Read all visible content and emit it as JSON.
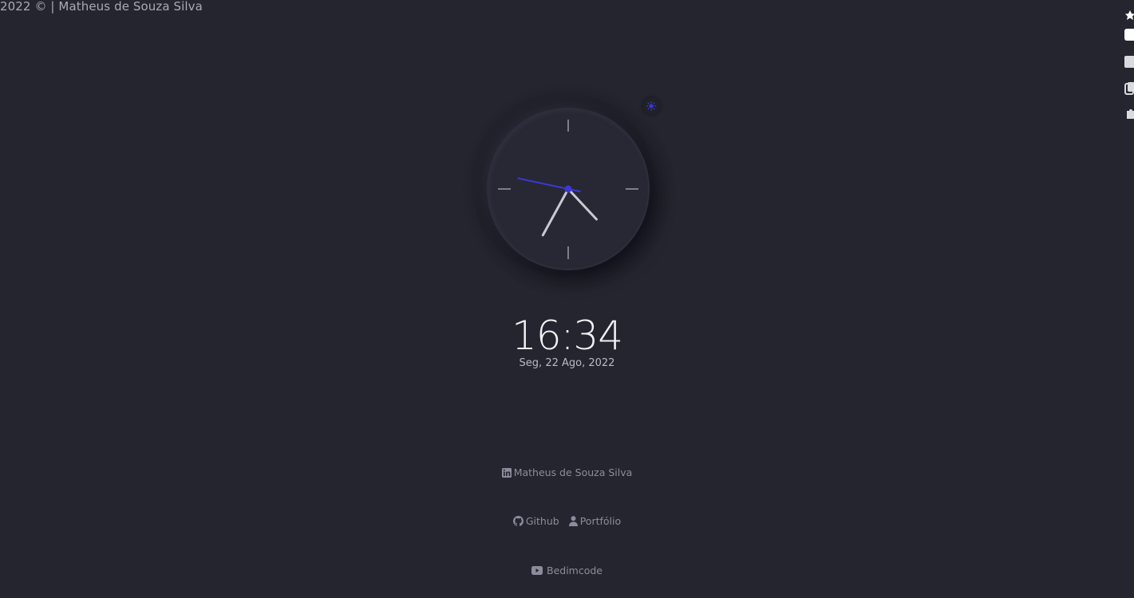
{
  "footer_top": {
    "copyright": "2022 © | Matheus de Souza Silva"
  },
  "clock": {
    "time_hours": 16,
    "time_minutes": 34,
    "time_seconds": 47,
    "accent_color": "#3b38d6",
    "hand_color": "#c9c9d2"
  },
  "digital": {
    "time": "16:34",
    "date": "Seg, 22 Ago, 2022"
  },
  "links": {
    "linkedin": "Matheus de Souza Silva",
    "github": "Github",
    "portfolio": "Portfólio",
    "youtube": "Bedimcode"
  },
  "icons": {
    "theme_toggle": "sun-icon",
    "linkedin": "linkedin-icon",
    "github": "github-icon",
    "portfolio": "user-icon",
    "youtube": "youtube-icon"
  }
}
